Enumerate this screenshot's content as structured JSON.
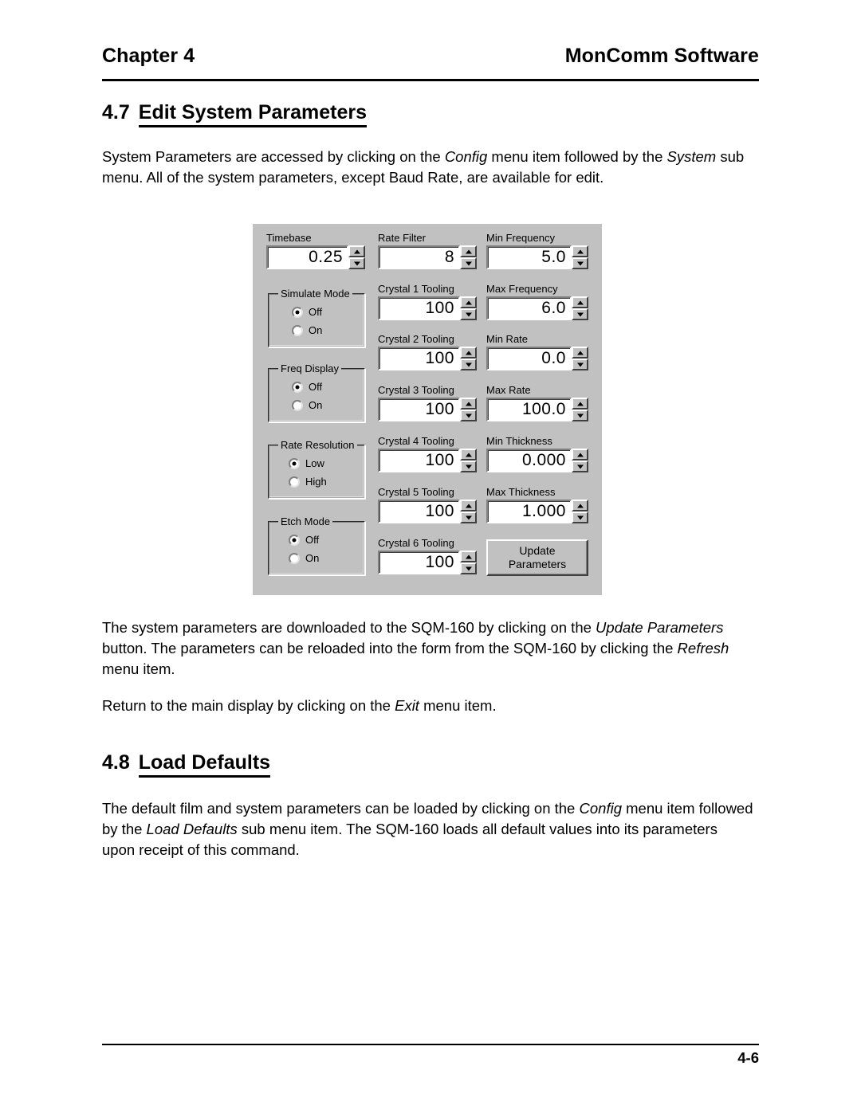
{
  "header": {
    "left": "Chapter 4",
    "right": "MonComm Software"
  },
  "footer": {
    "page_number": "4-6"
  },
  "sections": {
    "s47": {
      "number": "4.7",
      "title": "Edit System Parameters"
    },
    "s48": {
      "number": "4.8",
      "title": "Load Defaults"
    }
  },
  "paragraphs": {
    "p1_a": "System Parameters are accessed by clicking on the ",
    "p1_i1": "Config",
    "p1_b": " menu item followed by the ",
    "p1_i2": "System",
    "p1_c": " sub menu.  All of the system parameters, except Baud Rate, are available for edit.",
    "p2_a": "The system parameters are downloaded to the SQM-160 by clicking on the ",
    "p2_i1": "Update Parameters",
    "p2_b": " button. The parameters can be reloaded into the form from the SQM-160 by clicking the ",
    "p2_i2": "Refresh",
    "p2_c": " menu item.",
    "p3_a": "Return to the main display by clicking on the ",
    "p3_i1": "Exit",
    "p3_b": " menu item.",
    "p4_a": "The default film and system parameters can be loaded by clicking on the ",
    "p4_i1": "Config",
    "p4_b": " menu item followed by the ",
    "p4_i2": "Load Defaults",
    "p4_c": " sub menu item. The SQM-160 loads all default values into its parameters upon receipt of this command."
  },
  "dialog": {
    "background_color": "#c0c0c0",
    "spin_fields": {
      "timebase": {
        "label": "Timebase",
        "value": "0.25"
      },
      "rate_filter": {
        "label": "Rate Filter",
        "value": "8"
      },
      "crystal1": {
        "label": "Crystal 1 Tooling",
        "value": "100"
      },
      "crystal2": {
        "label": "Crystal 2 Tooling",
        "value": "100"
      },
      "crystal3": {
        "label": "Crystal 3 Tooling",
        "value": "100"
      },
      "crystal4": {
        "label": "Crystal 4 Tooling",
        "value": "100"
      },
      "crystal5": {
        "label": "Crystal 5 Tooling",
        "value": "100"
      },
      "crystal6": {
        "label": "Crystal 6 Tooling",
        "value": "100"
      },
      "min_frequency": {
        "label": "Min Frequency",
        "value": "5.0"
      },
      "max_frequency": {
        "label": "Max Frequency",
        "value": "6.0"
      },
      "min_rate": {
        "label": "Min Rate",
        "value": "0.0"
      },
      "max_rate": {
        "label": "Max Rate",
        "value": "100.0"
      },
      "min_thickness": {
        "label": "Min Thickness",
        "value": "0.000"
      },
      "max_thickness": {
        "label": "Max Thickness",
        "value": "1.000"
      }
    },
    "groups": {
      "simulate_mode": {
        "title": "Simulate Mode",
        "option1": "Off",
        "option2": "On",
        "selected": "Off"
      },
      "freq_display": {
        "title": "Freq Display",
        "option1": "Off",
        "option2": "On",
        "selected": "Off"
      },
      "rate_resolution": {
        "title": "Rate Resolution",
        "option1": "Low",
        "option2": "High",
        "selected": "Low"
      },
      "etch_mode": {
        "title": "Etch Mode",
        "option1": "Off",
        "option2": "On",
        "selected": "Off"
      }
    },
    "update_button": {
      "line1": "Update",
      "line2": "Parameters"
    }
  }
}
